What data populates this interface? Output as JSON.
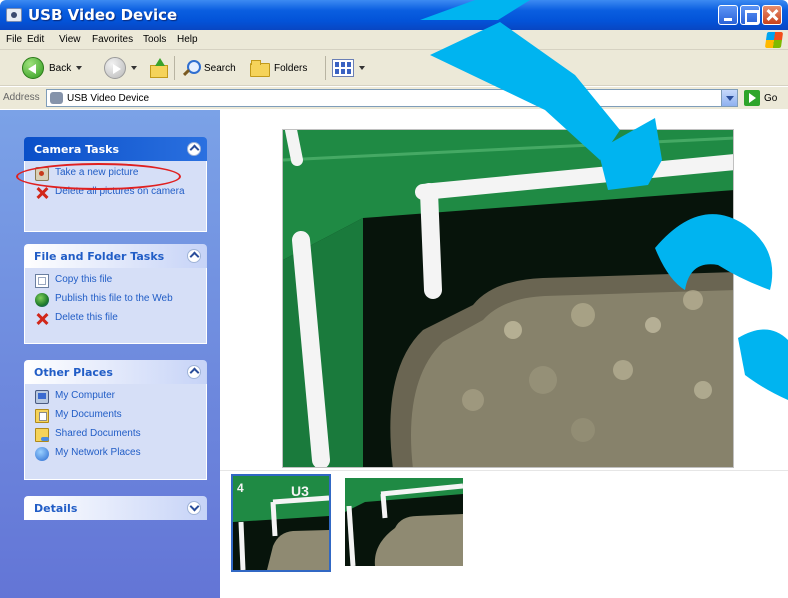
{
  "window": {
    "title": "USB Video Device"
  },
  "menu": [
    "File",
    "Edit",
    "View",
    "Favorites",
    "Tools",
    "Help"
  ],
  "toolbar": {
    "back_label": "Back",
    "search_label": "Search",
    "folders_label": "Folders"
  },
  "address": {
    "label": "Address",
    "value": "USB Video Device",
    "go_label": "Go"
  },
  "panels": {
    "camera_tasks": {
      "title": "Camera Tasks",
      "items": [
        {
          "label": "Take a new picture",
          "icon": "camera-icon"
        },
        {
          "label": "Delete all pictures on camera",
          "icon": "delete-x-icon"
        }
      ]
    },
    "file_folder_tasks": {
      "title": "File and Folder Tasks",
      "items": [
        {
          "label": "Copy this file",
          "icon": "copy-file-icon"
        },
        {
          "label": "Publish this file to the Web",
          "icon": "globe-icon"
        },
        {
          "label": "Delete this file",
          "icon": "delete-x-icon"
        }
      ]
    },
    "other_places": {
      "title": "Other Places",
      "items": [
        {
          "label": "My Computer",
          "icon": "computer-icon"
        },
        {
          "label": "My Documents",
          "icon": "documents-folder-icon"
        },
        {
          "label": "Shared Documents",
          "icon": "shared-folder-icon"
        },
        {
          "label": "My Network Places",
          "icon": "network-places-icon"
        }
      ]
    },
    "details": {
      "title": "Details"
    }
  },
  "thumbnails": {
    "first_overlay_text": "U3",
    "first_corner_text": "4"
  },
  "colors": {
    "title_bar": "#0a5ee0",
    "special_panel_header": "#0a4fc8",
    "pane_background": "#7ba2e7",
    "highlight_ellipse": "#e02020",
    "watermark": "#00b4f0",
    "pcb_green": "#1f8a44"
  }
}
